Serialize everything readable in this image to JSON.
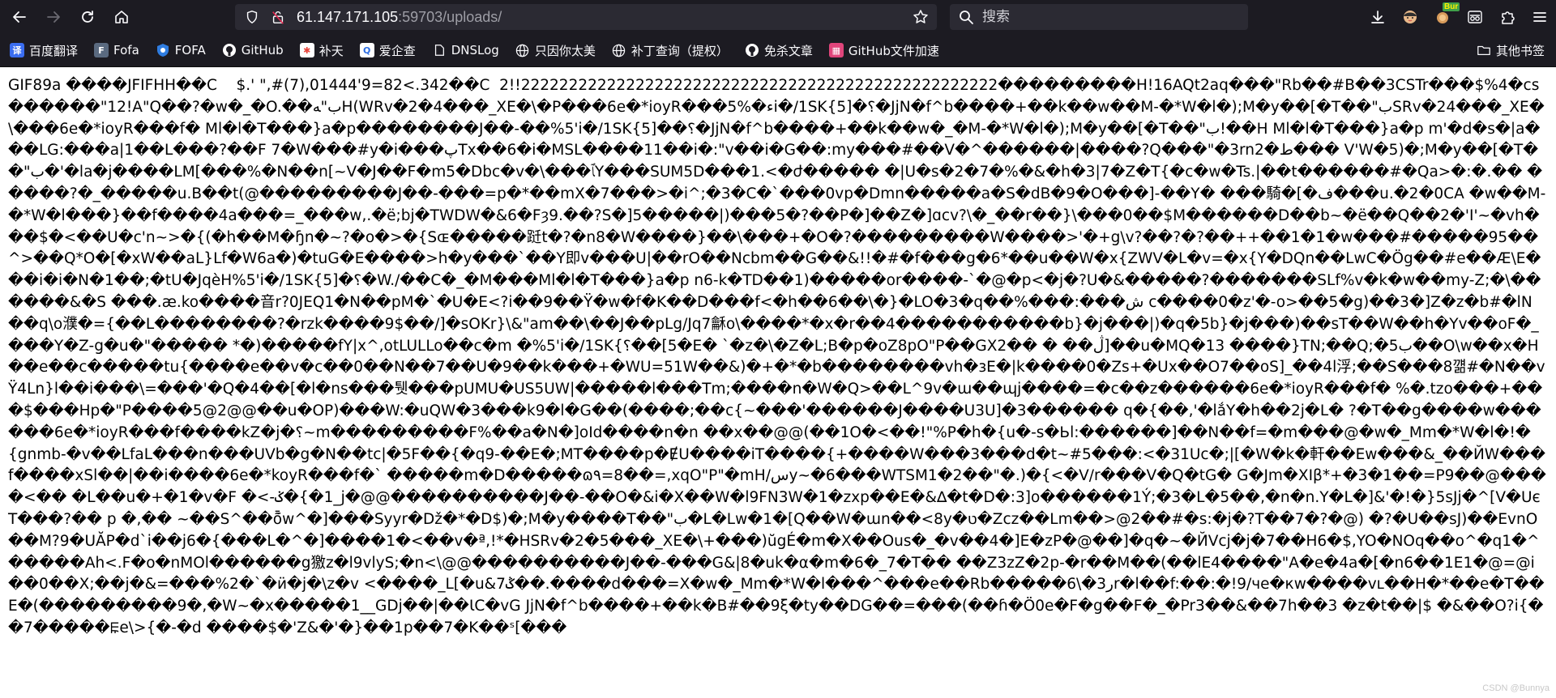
{
  "browser": {
    "url_host": "61.147.171.105",
    "url_port_path": ":59703/uploads/",
    "search_placeholder": "搜索",
    "extension_badge": "Bur"
  },
  "bookmarks": {
    "items": [
      {
        "label": "百度翻译",
        "icon": "translate-icon",
        "color": "#3a6df0"
      },
      {
        "label": "Fofa",
        "icon": "fofa-icon",
        "color": "#5a6a80"
      },
      {
        "label": "FOFA",
        "icon": "fofa-shield-icon",
        "color": "#2f7de1"
      },
      {
        "label": "GitHub",
        "icon": "github-icon",
        "color": "#ffffff"
      },
      {
        "label": "补天",
        "icon": "butian-icon",
        "color": "#e8453c"
      },
      {
        "label": "爱企查",
        "icon": "aiqicha-icon",
        "color": "#2c6de3"
      },
      {
        "label": "DNSLog",
        "icon": "dnslog-icon",
        "color": "#ffffff"
      },
      {
        "label": "只因你太美",
        "icon": "globe-icon",
        "color": "#ffffff"
      },
      {
        "label": "补丁查询（提权）",
        "icon": "globe-icon",
        "color": "#ffffff"
      },
      {
        "label": "免杀文章",
        "icon": "github-icon",
        "color": "#ffffff"
      },
      {
        "label": "GitHub文件加速",
        "icon": "accelerate-icon",
        "color": "#e0457b"
      }
    ],
    "other_label": "其他书签"
  },
  "page": {
    "text": "GIF89a ����JFIFHH��C    $.' \",#(7),01444'9=82<.342��C  2!!22222222222222222222222222222222222222222222222222���������H!16AQt2aq���\"Rb��#B��3CSTr���$%4�cs������\"12!A\"Q��?�w�_�O.��ب\"ﻪH(WRv�2�4���_XE�\\�P���6e�*ioyR���5%�ءi�/1SK{؟�[5�JjN�f^b����+��k��w��M-�*W�l�);M�y��[�T��\"بSRv�24���_XE�\\���6e�*ioyR���f� Ml�l�T���}a�p��������J��-��%5'i�/1SK{؟��[5�JjN�f^b����+��k��w�_�M-�*W�l�);M�y��[�T��\"ب!��H Ml�l�T���}a�p m'�d�s�|a���LG:���a|1��L���?��F 7�W���#y�i���پTx��6�i�MSL����11��i�:\"v��i�G��:my���#��V�^������|����?Q���\"�3rn2�ﻁ��� V'W�5)�;M�y��[�T��\"ب�'�la�j����LM[���%�N��n[~V�J��F�m5�Dbc�v�\\���ﭑY���SUM5D���1.<�ժ����� �|U�s�2�7�%�&�h�3|7�Z�T{�c�w�Ts.|��t������#�Qa>�:�.�� �����?�_�����u.B��t(@���������J��-���=p�*��mX�7���>�i^;�3�C�`���0vp�Dmn�����a�S�dB�9�O���]-��Y� ���騎�[�ف���u.�2�0CA �w��M-�*W�l���}��f����4a���=_���w,.�ë;bj�TWDW�&6�Fȝ9.��?S�]5�����|)���5�?��P�]��Z�]ɑcv?\\�_��r��}\\���0��$M������D��b~�ë��Q��2�'I'~�vh���$�<��U�c'n~>�{(�h��M�ɧn�~?�o�>�{Sɶ�����跹t�?�n8�W����}��\\���+�O�?���������W����>'�+g\\v?��?�?��++��1�1�w���#�����95��^>��Q*O�[�xW��aL}Lf�W6a�)�tuG�E����>h�y���`��Y即v���U|��rO��Ncbm��G��&!!�#�f���g�6*��u��W�x{ZWV�L�v=�x{Y�DQn��LwC�Ög��#e��Æ\\E���i�i�N�1��;�tU�JqèH%5'i�/1SK{؟�[5�W./��C�_�M���Ml�l�T���}a�p n6-k�TD��1)�����or����-`�@�p<�j�?U�&�����?�������SLf%v�k�w��my-Z;�\\������&�S ���.æ.ko����音r?0JEQ1�N��pM�`�U�E<?i��9��Ÿ�w�f�K��D���f<�h��6��\\�}�LO�3�q��%���:���ش c����0�z'�-o>��5�g)��3�]Z�z�b#�lN��q\\o濮�={��L��������?�rzk����9$��/]�sOKr}\\&\"am��\\��J��pLg/Jq7龢o\\����*�x�r��4�����������b}�j���|)�q�5b}�j���)��sT��W��h�Yv��oF�_���Y�Z-g�u�\"����� *�)�����fY|x^,otLULLo��ᴄ�m �%5'i�/1SK{؟��[5�E� `�z�\\�Z�L;B�p�oZ8pO\"P��GX2�� � ��ڷ]��u�MQ�13 ����}TN;��Q;�5ب��O\\w��x�H��e��c�����tu{����e��v�c��0��N��7��U�9��k���+�WU=51W��&)�+�*�b��������vh�ɜE�|k����0�Zs+�Ux��O7��oS]_��4l浮;��S���8꺪#�N��vŸ4Ln}l��i���\\=���'�Q�4��[�l�ns���퉷���pUMU�US5UW|�����l���Tm;����n�W�Q>��L^9v�ɯ��ɰj����=�c��z������6e�*ioyR���f� %�.tzo���+���$���Hp�\"P����5@2@@��u�OP)���W:�uQW�3���k9�l�G��(����;��c{~���'������J����U3U]�3������ q�{��,'�lắY�h��2j�L� ?�T��g����w������6e�*ioyR���f����kZ�j�؟~m���������F%��a�N�]oId����n�n ��x��@@(��1O�<��!\"%P�h�{u�-s�Ьl:������]��N��f=�m���@�w�_Mm�*W�l�!�{gnmb-�v��LfaL���n���UVb�g�N��tc|�5F��{�q9-��E�;MT����p�ɆU����iT����{+����W���3���d�t~#5���:<�31Uc�;|[�W�k�軒��Ew���&_��ЙW���f����xSl��|��i����6e�*koyR���f�` �����m�D�����ɷ٩=8��=,xqO\"P\"�mH/سy~�6���WTSM1�2��\"�.)�{<�V/r���V�Q�tG� G�Jm�XIβ*+�3�1��=P9��@����<�� �L��u�+�1�v�F �<-ݢ�{�1_j�@@����������J��-��O�&i�X��W�l9FN3W�1�zxp��E�&∆�t�D�:3]o������1Ý;�3�L�5��,�n�n.Y�L�]&'�!�}5sJj�^[V�UєT���?�� p �,�� ~��S^��ȭ̄w^�]���Syyr�Dž�*�D$)�;M�y����T��\"ب�L�Lw�1�[Q��W�ɯn��<8y�ט�Zcz��Lm��>@2��#�s:�j�?T��7�?�@) �?�U��sJ)��EvnO��M?9�UĂP�d`i��j6�{���L�^�]����1�<��v�ª,!*�HSRv�2�5���_XE�\\+���)ŭgÉ�m�X��Ous�_�v��4�]E�zP�@��]�q�~�ЙVcj�j�7��H6�$,YO�NOq��o^�q1�^�����Ah<.F�o�nMOl������g獥z�l9vlyS;�n<\\@@����������J��-���G&|8�uk�α�m�6�_7�T�� ��Z3zZ�2p-�r��M��(��lE4����\"A�e�4a�[�n6��1E1�@=@i��0��X;��j�&=���%2�`�ӥ�j�\\z�v <����_L[�u&7ݣ��.����d���=X�w�_Mm�*W�l���^���e��Rb�����6\\�3ﺭr�l��f:��:�!9/чe�кw����vʟ��H�*��e�T��E�(���������9�,�W~�x�����1__GDj��|��ƖC�vG JjN�f^b����+��k�B#��9ξ�ty��DG��=���(��ɦ�Ö0e�F�g��F�_�Pr3��&��7h��3 �z�t��|$ �&��O?i{��7�����ꡀe\\>{�-�d ����$�'Z&�'�}��1p��7�K��ˢ[���"
  },
  "watermark": "CSDN @Bunnya"
}
